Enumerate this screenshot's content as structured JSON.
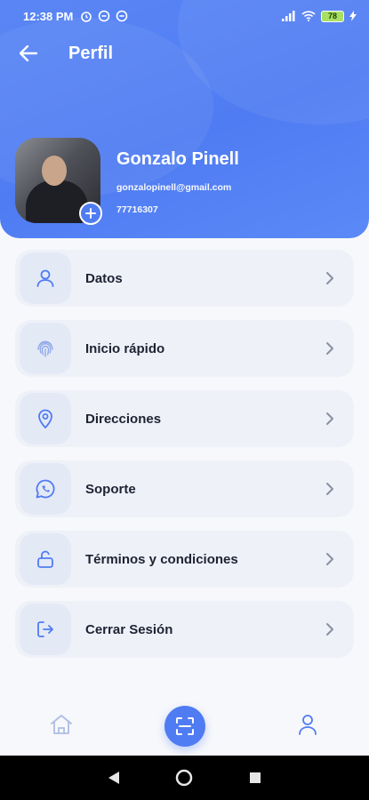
{
  "status_bar": {
    "time": "12:38 PM",
    "battery": "78"
  },
  "header": {
    "title": "Perfil"
  },
  "profile": {
    "name": "Gonzalo Pinell",
    "email": "gonzalopinell@gmail.com",
    "phone": "77716307"
  },
  "menu": {
    "items": [
      {
        "label": "Datos",
        "icon": "user-icon"
      },
      {
        "label": "Inicio rápido",
        "icon": "fingerprint-icon"
      },
      {
        "label": "Direcciones",
        "icon": "location-pin-icon"
      },
      {
        "label": "Soporte",
        "icon": "whatsapp-icon"
      },
      {
        "label": "Términos y condiciones",
        "icon": "unlock-icon"
      },
      {
        "label": "Cerrar Sesión",
        "icon": "logout-icon"
      }
    ]
  },
  "bottom_nav": {
    "items": [
      "home-icon",
      "scan-icon",
      "profile-icon"
    ]
  },
  "colors": {
    "primary": "#4f7cf2",
    "card": "#eef1f8",
    "icon_bg": "#e4e9f6"
  }
}
